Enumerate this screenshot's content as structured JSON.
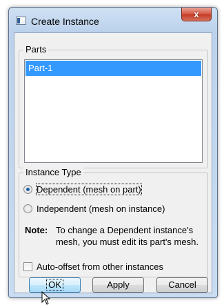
{
  "window": {
    "title": "Create Instance",
    "close_label": "x"
  },
  "parts": {
    "group_label": "Parts",
    "items": [
      "Part-1"
    ]
  },
  "instance_type": {
    "group_label": "Instance Type",
    "options": [
      {
        "label": "Dependent (mesh on part)",
        "checked": true
      },
      {
        "label": "Independent (mesh on instance)",
        "checked": false
      }
    ],
    "note_title": "Note:",
    "note_text": "To change a Dependent instance's mesh, you must edit its part's mesh."
  },
  "auto_offset": {
    "label": "Auto-offset from other instances",
    "checked": false
  },
  "buttons": {
    "ok": "OK",
    "apply": "Apply",
    "cancel": "Cancel"
  },
  "colors": {
    "selection": "#3399ff",
    "close_button": "#c43c28"
  }
}
